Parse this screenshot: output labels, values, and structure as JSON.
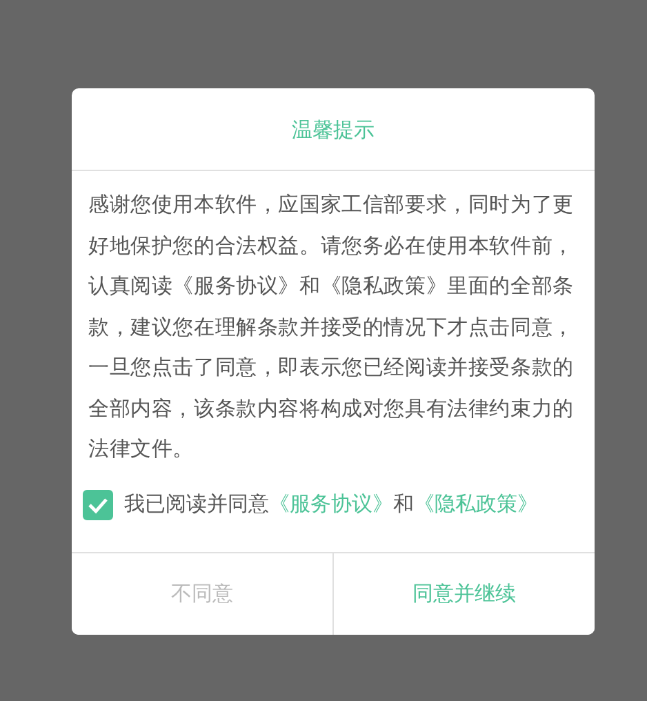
{
  "dialog": {
    "title": "温馨提示",
    "message": "感谢您使用本软件，应国家工信部要求，同时为了更好地保护您的合法权益。请您务必在使用本软件前，认真阅读《服务协议》和《隐私政策》里面的全部条款，建议您在理解条款并接受的情况下才点击同意，一旦您点击了同意，即表示您已经阅读并接受条款的全部内容，该条款内容将构成对您具有法律约束力的法律文件。",
    "consent": {
      "checked": true,
      "parts": [
        {
          "kind": "text",
          "text": "我已阅读并同意"
        },
        {
          "kind": "link",
          "text": "《服务协议》"
        },
        {
          "kind": "text",
          "text": "和"
        },
        {
          "kind": "link",
          "text": "《隐私政策》"
        }
      ]
    },
    "buttons": [
      {
        "label": "不同意",
        "kind": "secondary"
      },
      {
        "label": "同意并继续",
        "kind": "primary"
      }
    ]
  }
}
